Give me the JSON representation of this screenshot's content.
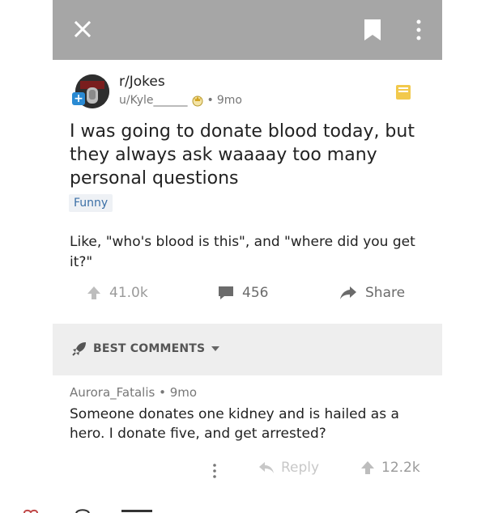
{
  "post": {
    "subreddit": "r/Jokes",
    "author": "u/Kyle______",
    "age": "9mo",
    "title": "I was going to donate blood today, but they always ask waaaay too many personal questions",
    "flair": "Funny",
    "body": "Like, \"who's blood is this\", and \"where did you get it?\""
  },
  "actions": {
    "upvotes": "41.0k",
    "comments": "456",
    "share": "Share"
  },
  "comments_header": {
    "sort_label": "BEST COMMENTS"
  },
  "comment": {
    "author": "Aurora_Fatalis",
    "age": "9mo",
    "text": "Someone donates one kidney and is hailed as a hero. I donate five, and get arrested?",
    "reply": "Reply",
    "score": "12.2k"
  },
  "colors": {
    "topbar": "#a6a6a6",
    "save_accent": "#f2c94c",
    "flair_text": "#3b6fa6"
  },
  "icons": [
    "close-icon",
    "bookmark-icon",
    "more-icon",
    "save-icon",
    "upvote-icon",
    "comment-icon",
    "share-icon",
    "rocket-icon",
    "chevron-down-icon",
    "reply-icon"
  ]
}
